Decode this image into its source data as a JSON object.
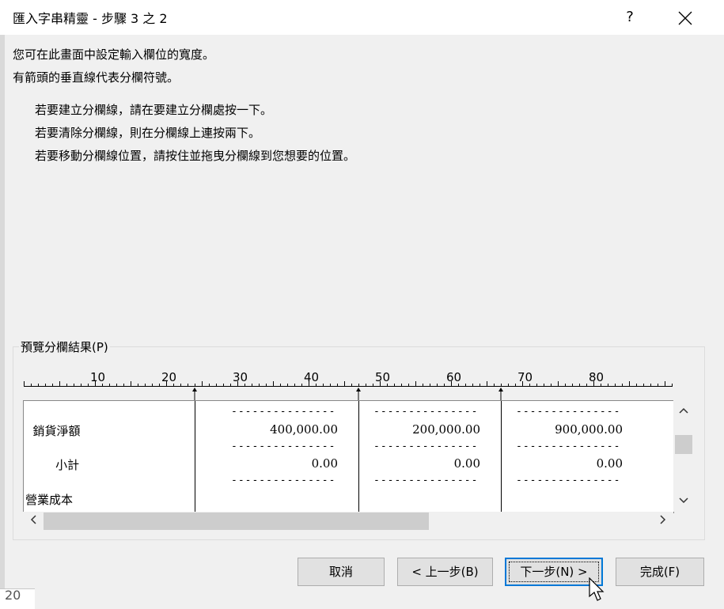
{
  "window": {
    "title": "匯入字串精靈 - 步驟 3 之 2",
    "help": "?",
    "close_icon": "close-icon"
  },
  "intro": [
    "您可在此畫面中設定輸入欄位的寬度。",
    "有箭頭的垂直線代表分欄符號。"
  ],
  "instructions": [
    "若要建立分欄線，請在要建立分欄處按一下。",
    "若要清除分欄線，則在分欄線上連按兩下。",
    "若要移動分欄線位置，請按住並拖曳分欄線到您想要的位置。"
  ],
  "preview": {
    "label": "預覽分欄結果(P)",
    "ruler_labels": [
      "10",
      "20",
      "30",
      "40",
      "50",
      "60",
      "70",
      "80"
    ],
    "rows": [
      {
        "c1": "",
        "c2": "---------------",
        "c3": "---------------",
        "c4": "---------------"
      },
      {
        "c1": "  銷貨淨額",
        "c2": "400,000.00",
        "c3": "200,000.00",
        "c4": "900,000.00"
      },
      {
        "c1": "",
        "c2": "---------------",
        "c3": "---------------",
        "c4": "---------------"
      },
      {
        "c1": "        小計",
        "c2": "0.00",
        "c3": "0.00",
        "c4": "0.00"
      },
      {
        "c1": "",
        "c2": "---------------",
        "c3": "---------------",
        "c4": "---------------"
      },
      {
        "c1": "營業成本",
        "c2": "",
        "c3": "",
        "c4": ""
      }
    ]
  },
  "buttons": {
    "cancel": "取消",
    "back": "< 上一步(B)",
    "next": "下一步(N) >",
    "finish": "完成(F)"
  },
  "background_cell": "20"
}
